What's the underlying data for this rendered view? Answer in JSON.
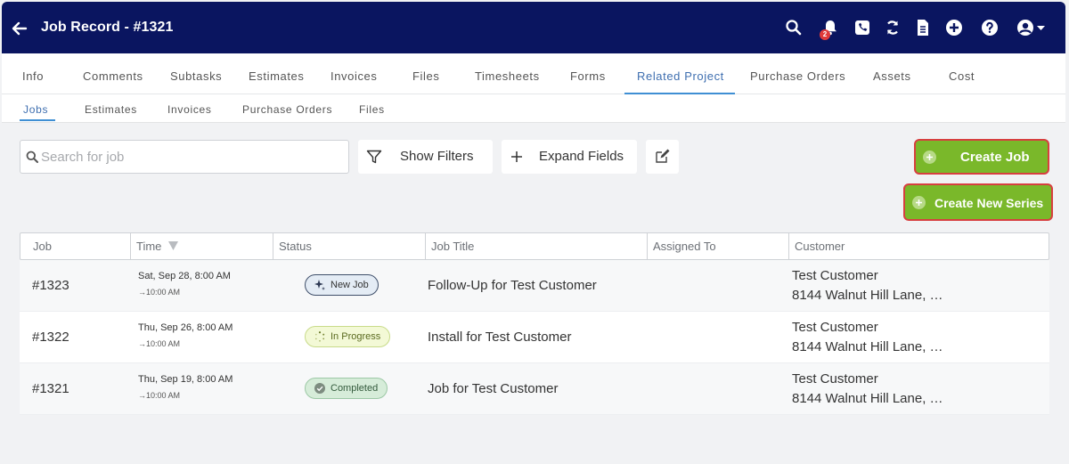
{
  "header": {
    "title": "Job Record - #1321",
    "notification_count": "2"
  },
  "tabs": [
    "Info",
    "Comments",
    "Subtasks",
    "Estimates",
    "Invoices",
    "Files",
    "Timesheets",
    "Forms",
    "Related Project",
    "Purchase Orders",
    "Assets",
    "Cost"
  ],
  "active_tab": "Related Project",
  "subtabs": [
    "Jobs",
    "Estimates",
    "Invoices",
    "Purchase Orders",
    "Files"
  ],
  "active_subtab": "Jobs",
  "toolbar": {
    "search_placeholder": "Search for job",
    "show_filters": "Show Filters",
    "expand_fields": "Expand Fields",
    "create_job": "Create Job",
    "create_series": "Create New Series"
  },
  "table": {
    "columns": [
      "Job",
      "Time",
      "Status",
      "Job Title",
      "Assigned To",
      "Customer"
    ],
    "rows": [
      {
        "job": "#1323",
        "time": "Sat, Sep 28, 8:00 AM",
        "end": "→10:00 AM",
        "status": "New Job",
        "title": "Follow-Up for Test Customer",
        "assigned": "",
        "customer": "Test Customer",
        "address": "8144 Walnut Hill Lane, …"
      },
      {
        "job": "#1322",
        "time": "Thu, Sep 26, 8:00 AM",
        "end": "→10:00 AM",
        "status": "In Progress",
        "title": "Install for Test Customer",
        "assigned": "",
        "customer": "Test Customer",
        "address": "8144 Walnut Hill Lane, …"
      },
      {
        "job": "#1321",
        "time": "Thu, Sep 19, 8:00 AM",
        "end": "→10:00 AM",
        "status": "Completed",
        "title": "Job for Test Customer",
        "assigned": "",
        "customer": "Test Customer",
        "address": "8144 Walnut Hill Lane, …"
      }
    ]
  },
  "colors": {
    "header_bg": "#0a1560",
    "accent": "#3f8fd4",
    "create_green": "#7ab82a",
    "highlight_red": "#d73f3f",
    "status_new_bg": "#e4ecf5",
    "status_progress_bg": "#f3f9d6",
    "status_completed_bg": "#d6ecd9"
  }
}
